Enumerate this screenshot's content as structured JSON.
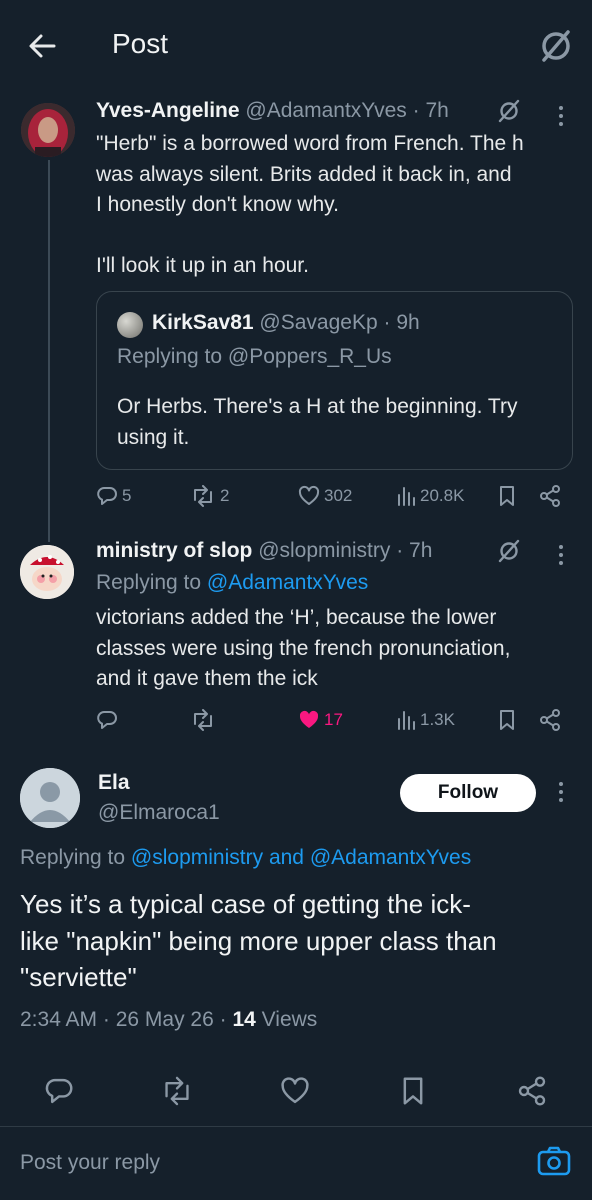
{
  "header": {
    "title": "Post"
  },
  "tweets": [
    {
      "display_name": "Yves-Angeline",
      "handle": "@AdamantxYves",
      "time": "· 7h",
      "text": "\"Herb\" is a borrowed word from French. The h\nwas always silent. Brits added it back in, and\nI honestly don't know why.\n\nI'll look it up in an hour.",
      "quote": {
        "display_name": "KirkSav81",
        "handle": "@SavageKp",
        "time": "· 9h",
        "replying_prefix": "Replying to",
        "replying_to": "@Poppers_R_Us",
        "text": "Or Herbs. There's a H at the beginning. Try\nusing it."
      },
      "stats": {
        "replies": "5",
        "reposts": "2",
        "likes": "302",
        "views": "20.8K"
      }
    },
    {
      "display_name": "ministry of slop",
      "handle": "@slopministry",
      "time": "· 7h",
      "replying_prefix": "Replying to",
      "replying_to": "@AdamantxYves",
      "text": "victorians added the ‘H’, because the lower\nclasses were using the french pronunciation,\nand it gave them the ick",
      "stats": {
        "replies": "",
        "reposts": "",
        "likes": "17",
        "views": "1.3K"
      }
    }
  ],
  "main_post": {
    "display_name": "Ela",
    "handle": "@Elmaroca1",
    "follow_label": "Follow",
    "replying_prefix": "Replying to",
    "replying_to_1": "@slopministry",
    "replying_and": "and",
    "replying_to_2": "@AdamantxYves",
    "text": "Yes it’s a typical case of getting the ick-\nlike \"napkin\" being more upper class than\n\"serviette\"",
    "time": "2:34 AM",
    "date": "· 26 May 26 ·",
    "views_count": "14",
    "views_label": "Views"
  },
  "reply_box": {
    "placeholder": "Post your reply"
  },
  "colors": {
    "background": "#15202b",
    "accent": "#1d9bf0",
    "like": "#f91880",
    "muted": "#8b98a5"
  }
}
